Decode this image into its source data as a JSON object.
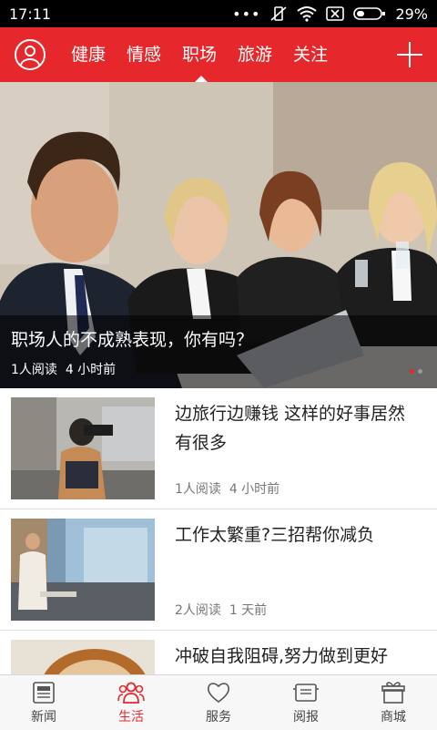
{
  "status": {
    "time": "17:11",
    "battery": "29%"
  },
  "nav": {
    "tabs": [
      {
        "label": "健康"
      },
      {
        "label": "情感"
      },
      {
        "label": "职场"
      },
      {
        "label": "旅游"
      },
      {
        "label": "关注"
      }
    ],
    "active_tab": "职场"
  },
  "hero": {
    "title": "职场人的不成熟表现，你有吗？",
    "reads": "1人阅读",
    "time": "4 小时前"
  },
  "articles": [
    {
      "title": "边旅行边赚钱 这样的好事居然有很多",
      "reads": "1人阅读",
      "time": "4 小时前"
    },
    {
      "title": "工作太繁重?三招帮你减负",
      "reads": "2人阅读",
      "time": "1 天前"
    },
    {
      "title": "冲破自我阻碍,努力做到更好",
      "reads": "",
      "time": ""
    }
  ],
  "bottom_nav": [
    {
      "label": "新闻",
      "icon": "newspaper-icon"
    },
    {
      "label": "生活",
      "icon": "people-icon"
    },
    {
      "label": "服务",
      "icon": "heart-icon"
    },
    {
      "label": "阅报",
      "icon": "reader-icon"
    },
    {
      "label": "商城",
      "icon": "gift-icon"
    }
  ],
  "colors": {
    "accent": "#e6272c"
  }
}
